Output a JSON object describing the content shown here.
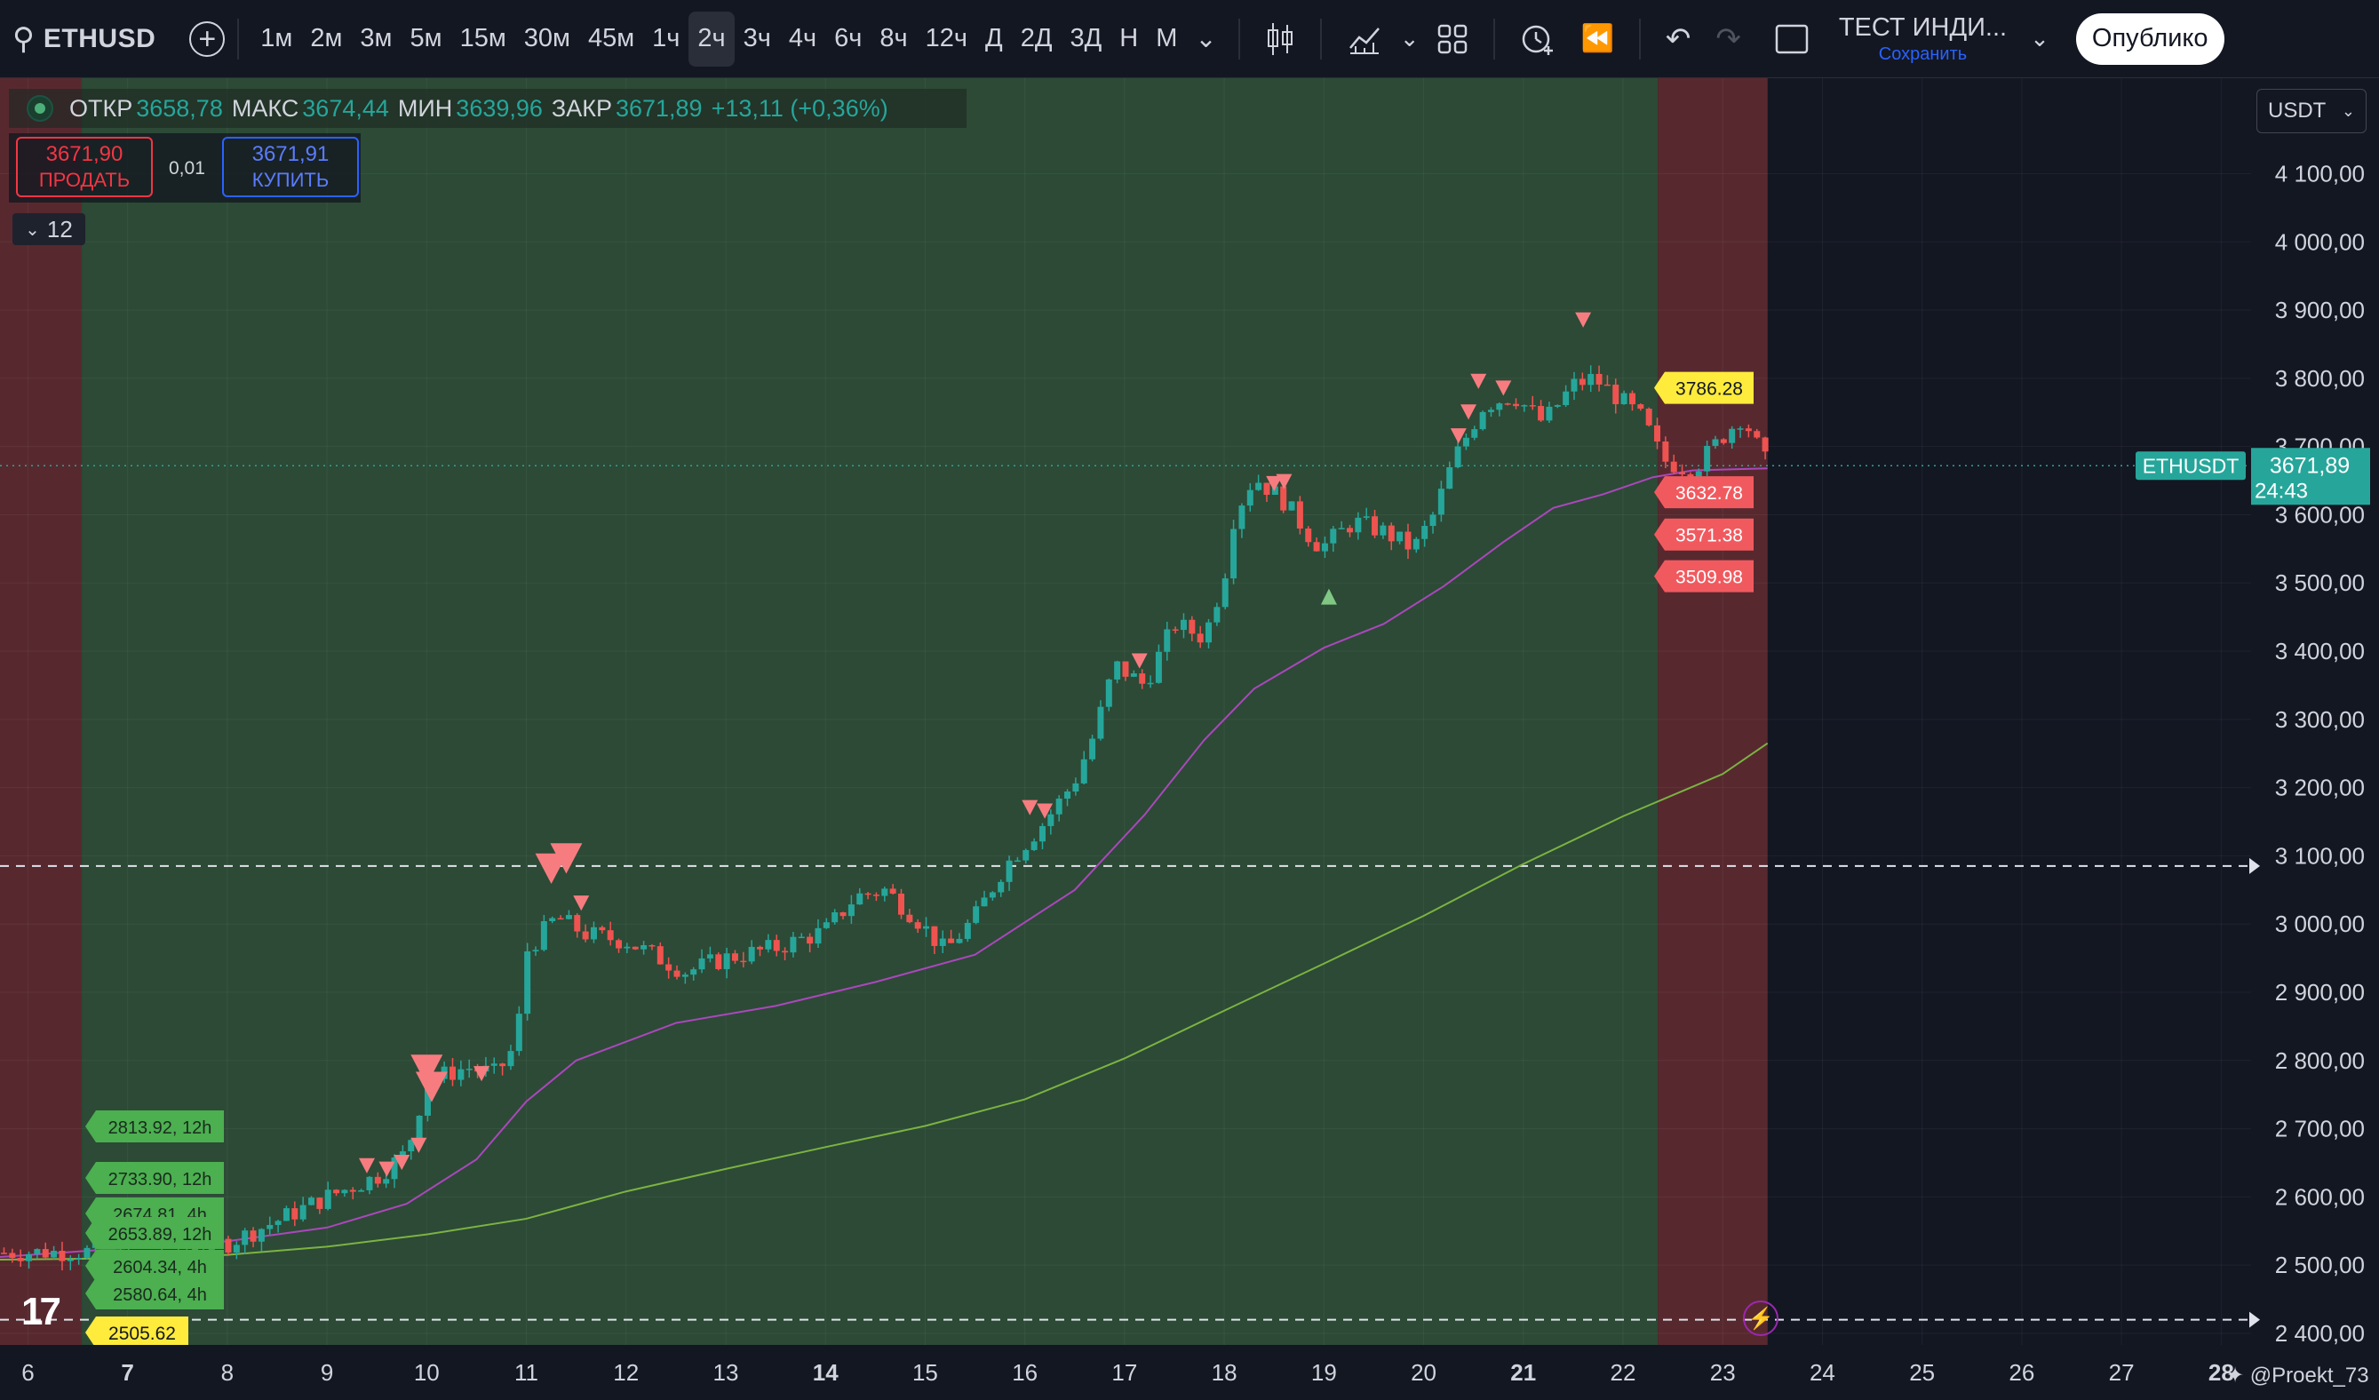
{
  "toolbar": {
    "symbol": "ETHUSD",
    "timeframes": [
      "1м",
      "2м",
      "3м",
      "5м",
      "15м",
      "30м",
      "45м",
      "1ч",
      "2ч",
      "3ч",
      "4ч",
      "6ч",
      "8ч",
      "12ч",
      "Д",
      "2Д",
      "3Д",
      "Н",
      "М"
    ],
    "active_timeframe": "2ч",
    "layout_name": "ТЕСТ ИНДИ...",
    "save_label": "Сохранить",
    "publish_label": "Опублико"
  },
  "ohlc": {
    "open_label": "ОТКР",
    "open": "3658,78",
    "high_label": "МАКС",
    "high": "3674,44",
    "low_label": "МИН",
    "low": "3639,96",
    "close_label": "ЗАКР",
    "close": "3671,89",
    "change": "+13,11 (+0,36%)"
  },
  "trade": {
    "sell_price": "3671,90",
    "sell_label": "ПРОДАТЬ",
    "spread": "0,01",
    "buy_price": "3671,91",
    "buy_label": "КУПИТЬ"
  },
  "indicators_collapse": "12",
  "currency": "USDT",
  "author": "@Proekt_73",
  "colors": {
    "background": "#131722",
    "up": "#26a69a",
    "down": "#ef5350",
    "green_zone": "#2c4a36",
    "red_zone": "#57292f",
    "ma_fast": "#ab47bc",
    "ma_slow": "#7cb342",
    "label_yellow": "#ffeb3b",
    "label_green": "#4caf50",
    "label_red": "#f23645"
  },
  "chart_data": {
    "type": "candlestick",
    "symbol": "ETHUSDT",
    "current_price": "3671,89",
    "countdown": "24:43",
    "y_ticks": [
      "4 100,00",
      "4 000,00",
      "3 900,00",
      "3 800,00",
      "3 700,00",
      "3 600,00",
      "3 500,00",
      "3 400,00",
      "3 300,00",
      "3 200,00",
      "3 100,00",
      "3 000,00",
      "2 900,00",
      "2 800,00",
      "2 700,00",
      "2 600,00",
      "2 500,00",
      "2 400,00"
    ],
    "y_tick_values": [
      4100,
      4000,
      3900,
      3800,
      3700,
      3600,
      3500,
      3400,
      3300,
      3200,
      3100,
      3000,
      2900,
      2800,
      2700,
      2600,
      2500,
      2400
    ],
    "ylim": [
      2383,
      4240
    ],
    "x_ticks": [
      "6",
      "7",
      "8",
      "9",
      "10",
      "11",
      "12",
      "13",
      "14",
      "15",
      "16",
      "17",
      "18",
      "19",
      "20",
      "21",
      "22",
      "23",
      "24",
      "25",
      "26",
      "27",
      "28"
    ],
    "bold_x_ticks": [
      "7",
      "14",
      "21",
      "28"
    ],
    "xlim": [
      5.72,
      28.3
    ],
    "horizontal_lines": [
      3085,
      2420
    ],
    "zones": [
      {
        "color": "red",
        "from": 5.72,
        "to": 6.54
      },
      {
        "color": "green",
        "from": 6.54,
        "to": 22.35
      },
      {
        "color": "red",
        "from": 22.35,
        "to": 23.45
      }
    ],
    "price_path": [
      [
        5.72,
        2518
      ],
      [
        6.6,
        2520
      ],
      [
        7.0,
        2540
      ],
      [
        7.6,
        2527
      ],
      [
        8.0,
        2532
      ],
      [
        8.5,
        2565
      ],
      [
        9.0,
        2600
      ],
      [
        9.5,
        2630
      ],
      [
        9.8,
        2665
      ],
      [
        10.0,
        2770
      ],
      [
        10.4,
        2790
      ],
      [
        10.7,
        2780
      ],
      [
        10.9,
        2825
      ],
      [
        11.0,
        2960
      ],
      [
        11.3,
        3010
      ],
      [
        11.6,
        2985
      ],
      [
        12.0,
        2975
      ],
      [
        12.4,
        2945
      ],
      [
        12.6,
        2930
      ],
      [
        13.0,
        2950
      ],
      [
        13.5,
        2965
      ],
      [
        14.0,
        2990
      ],
      [
        14.3,
        3040
      ],
      [
        14.6,
        3050
      ],
      [
        14.9,
        3010
      ],
      [
        15.2,
        2960
      ],
      [
        15.5,
        3010
      ],
      [
        15.8,
        3085
      ],
      [
        16.2,
        3150
      ],
      [
        16.5,
        3210
      ],
      [
        16.7,
        3280
      ],
      [
        16.9,
        3380
      ],
      [
        17.2,
        3350
      ],
      [
        17.5,
        3440
      ],
      [
        17.8,
        3420
      ],
      [
        18.0,
        3510
      ],
      [
        18.1,
        3600
      ],
      [
        18.3,
        3655
      ],
      [
        18.6,
        3620
      ],
      [
        18.9,
        3560
      ],
      [
        19.0,
        3555
      ],
      [
        19.3,
        3590
      ],
      [
        19.6,
        3575
      ],
      [
        19.9,
        3550
      ],
      [
        20.1,
        3600
      ],
      [
        20.3,
        3680
      ],
      [
        20.6,
        3760
      ],
      [
        20.9,
        3775
      ],
      [
        21.2,
        3735
      ],
      [
        21.5,
        3790
      ],
      [
        21.7,
        3800
      ],
      [
        21.8,
        3790
      ],
      [
        22.0,
        3765
      ],
      [
        22.2,
        3740
      ],
      [
        22.4,
        3680
      ],
      [
        22.7,
        3665
      ],
      [
        23.0,
        3715
      ],
      [
        23.2,
        3745
      ],
      [
        23.35,
        3700
      ],
      [
        23.45,
        3672
      ]
    ],
    "ma_fast": [
      [
        5.72,
        2512
      ],
      [
        7.0,
        2525
      ],
      [
        8.0,
        2535
      ],
      [
        9.0,
        2555
      ],
      [
        9.8,
        2590
      ],
      [
        10.5,
        2655
      ],
      [
        11.0,
        2740
      ],
      [
        11.5,
        2800
      ],
      [
        12.5,
        2855
      ],
      [
        13.5,
        2880
      ],
      [
        14.5,
        2915
      ],
      [
        15.5,
        2955
      ],
      [
        16.5,
        3050
      ],
      [
        17.2,
        3160
      ],
      [
        17.8,
        3270
      ],
      [
        18.3,
        3345
      ],
      [
        19.0,
        3405
      ],
      [
        19.6,
        3440
      ],
      [
        20.2,
        3495
      ],
      [
        20.8,
        3560
      ],
      [
        21.3,
        3610
      ],
      [
        21.8,
        3630
      ],
      [
        22.3,
        3655
      ],
      [
        22.7,
        3665
      ],
      [
        23.45,
        3668
      ]
    ],
    "ma_slow": [
      [
        5.72,
        2508
      ],
      [
        7.0,
        2510
      ],
      [
        8.0,
        2515
      ],
      [
        9.0,
        2527
      ],
      [
        10.0,
        2545
      ],
      [
        11.0,
        2568
      ],
      [
        12.0,
        2608
      ],
      [
        13.0,
        2641
      ],
      [
        14.0,
        2673
      ],
      [
        15.0,
        2704
      ],
      [
        16.0,
        2743
      ],
      [
        17.0,
        2803
      ],
      [
        18.0,
        2873
      ],
      [
        19.0,
        2942
      ],
      [
        20.0,
        3012
      ],
      [
        21.0,
        3088
      ],
      [
        22.0,
        3158
      ],
      [
        23.0,
        3220
      ],
      [
        23.45,
        3265
      ]
    ],
    "sell_markers": [
      {
        "x": 9.4,
        "y": 2645,
        "size": "s"
      },
      {
        "x": 9.6,
        "y": 2640,
        "size": "s"
      },
      {
        "x": 9.75,
        "y": 2650,
        "size": "s"
      },
      {
        "x": 10.0,
        "y": 2785,
        "size": "l"
      },
      {
        "x": 10.05,
        "y": 2760,
        "size": "l"
      },
      {
        "x": 9.92,
        "y": 2675,
        "size": "s"
      },
      {
        "x": 10.55,
        "y": 2780,
        "size": "s"
      },
      {
        "x": 11.25,
        "y": 3080,
        "size": "l"
      },
      {
        "x": 11.4,
        "y": 3095,
        "size": "l"
      },
      {
        "x": 11.55,
        "y": 3030,
        "size": "s"
      },
      {
        "x": 16.05,
        "y": 3170,
        "size": "s"
      },
      {
        "x": 16.2,
        "y": 3165,
        "size": "s"
      },
      {
        "x": 17.15,
        "y": 3385,
        "size": "s"
      },
      {
        "x": 18.5,
        "y": 3645,
        "size": "s"
      },
      {
        "x": 18.6,
        "y": 3648,
        "size": "s"
      },
      {
        "x": 20.35,
        "y": 3715,
        "size": "s"
      },
      {
        "x": 20.45,
        "y": 3750,
        "size": "s"
      },
      {
        "x": 20.55,
        "y": 3795,
        "size": "s"
      },
      {
        "x": 20.8,
        "y": 3785,
        "size": "s"
      },
      {
        "x": 21.6,
        "y": 3885,
        "size": "s"
      }
    ],
    "buy_markers": [
      {
        "x": 19.05,
        "y": 3480
      }
    ],
    "price_labels": [
      {
        "text": "3786.28",
        "y": 3786,
        "color": "yellow"
      },
      {
        "text": "3632.78",
        "y": 3633,
        "color": "red"
      },
      {
        "text": "3571.38",
        "y": 3571,
        "color": "red"
      },
      {
        "text": "3509.98",
        "y": 3510,
        "color": "red"
      }
    ],
    "left_labels": [
      {
        "text": "2813.92, 12h",
        "y": 2814
      },
      {
        "text": "2733.90, 12h",
        "y": 2734
      },
      {
        "text": "2674.81, 4h",
        "y": 2673
      },
      {
        "text": "2653.89, 12h",
        "y": 2654
      },
      {
        "text": "2604.34, 4h",
        "y": 2604
      },
      {
        "text": "2580.64, 4h",
        "y": 2580
      }
    ],
    "bottom_left_label": {
      "text": "2505.62",
      "y": 2506
    }
  }
}
